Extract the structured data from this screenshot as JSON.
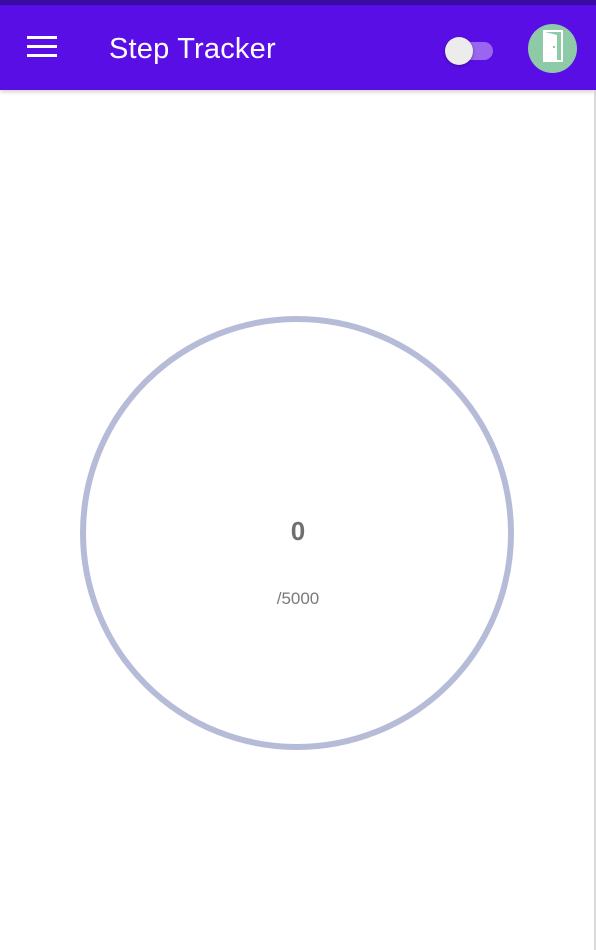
{
  "app_bar": {
    "title": "Step Tracker",
    "menu_icon": "hamburger-menu-icon",
    "toggle": {
      "state": "off"
    },
    "logout_icon": "door-exit-icon",
    "colors": {
      "bar": "#5a0ee6",
      "status_strip": "#3a0ca3",
      "logout_bg": "#8ec9a8"
    }
  },
  "progress": {
    "steps": "0",
    "goal_label": "/5000",
    "fraction": 0,
    "ring_color": "#b6bcd8"
  }
}
